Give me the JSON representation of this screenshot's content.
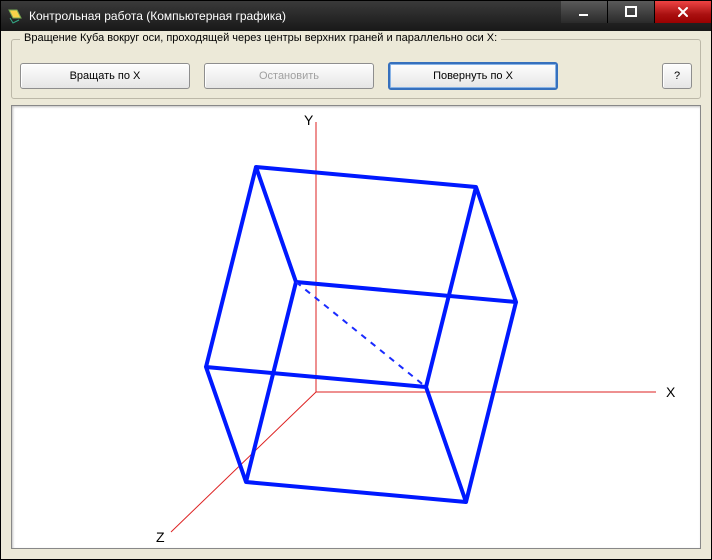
{
  "window": {
    "title": "Контрольная работа (Компьютерная графика)"
  },
  "groupbox": {
    "legend": "Вращение Куба вокруг оси, проходящей через центры верхних граней и параллельно оси X:"
  },
  "buttons": {
    "rotate": "Вращать по X",
    "stop": "Остановить",
    "turn": "Повернуть по X",
    "help": "?"
  },
  "axes": {
    "x": "X",
    "y": "Y",
    "z": "Z"
  },
  "colors": {
    "axis": "#d22",
    "cube": "#0019ff",
    "hidden": "#1a2bff"
  }
}
